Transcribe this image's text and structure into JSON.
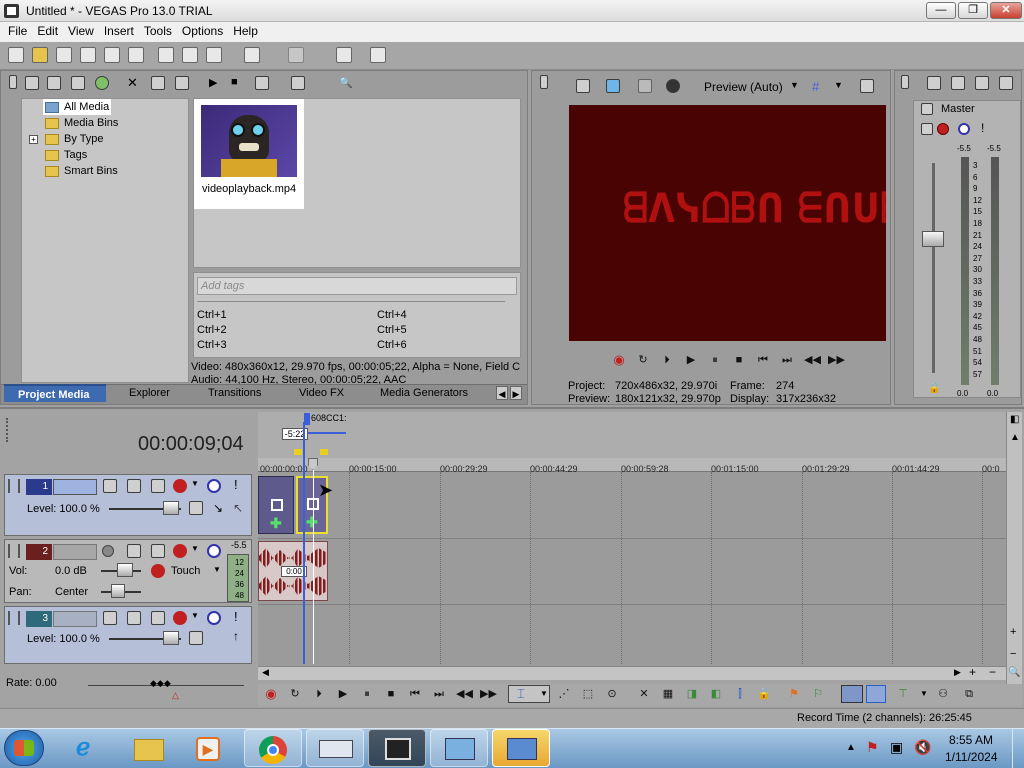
{
  "window": {
    "title": "Untitled * - VEGAS Pro 13.0 TRIAL",
    "minimize": "—",
    "maximize": "❐",
    "close": "✕"
  },
  "menu": [
    "File",
    "Edit",
    "View",
    "Insert",
    "Tools",
    "Options",
    "Help"
  ],
  "media_tree": [
    "All Media",
    "Media Bins",
    "By Type",
    "Tags",
    "Smart Bins"
  ],
  "media_item": {
    "filename": "videoplayback.mp4"
  },
  "tags": {
    "placeholder": "Add tags",
    "shortcuts": [
      "Ctrl+1",
      "Ctrl+2",
      "Ctrl+3",
      "Ctrl+4",
      "Ctrl+5",
      "Ctrl+6"
    ]
  },
  "media_info": {
    "video": "Video: 480x360x12, 29.970 fps, 00:00:05;22, Alpha = None, Field C",
    "audio": "Audio: 44,100 Hz, Stereo, 00:00:05;22, AAC"
  },
  "tabs": [
    "Project Media",
    "Explorer",
    "Transitions",
    "Video FX",
    "Media Generators"
  ],
  "preview": {
    "mode_label": "Preview (Auto)",
    "project_label": "Project:",
    "project_value": "720x486x32, 29.970i",
    "preview_label": "Preview:",
    "preview_value": "180x121x32, 29.970p",
    "frame_label": "Frame:",
    "frame_value": "274",
    "display_label": "Display:",
    "display_value": "317x236x32",
    "overlay_text": "ᗺᐱᓭᗝᗷᑎ ᗴᑎᑌᗷ"
  },
  "master": {
    "label": "Master",
    "left_db": "-5.5",
    "right_db": "-5.5",
    "ticks": [
      "3",
      "6",
      "9",
      "12",
      "15",
      "18",
      "21",
      "24",
      "27",
      "30",
      "33",
      "36",
      "39",
      "42",
      "45",
      "48",
      "51",
      "54",
      "57"
    ],
    "bottom_left": "0.0",
    "bottom_right": "0.0"
  },
  "timeline": {
    "timecode": "00:00:09;04",
    "marker_label": "608CC1:",
    "region_label": "-5:22",
    "ruler": [
      "00:00:00;00",
      "00:00:15;00",
      "00:00:29;29",
      "00:00:44;29",
      "00:00:59;28",
      "00:01:15;00",
      "00:01:29;29",
      "00:01:44;29",
      "00:0"
    ],
    "clip_audio_label": "0:00"
  },
  "tracks": [
    {
      "num": "1",
      "level_label": "Level: 100.0 %"
    },
    {
      "num": "2",
      "vol_label": "Vol:",
      "vol_value": "0.0 dB",
      "pan_label": "Pan:",
      "pan_value": "Center",
      "automation": "Touch",
      "meter_top": "-5.5",
      "meter_ticks": [
        "12",
        "24",
        "36",
        "48"
      ]
    },
    {
      "num": "3",
      "level_label": "Level: 100.0 %"
    }
  ],
  "rate": "Rate: 0.00",
  "status": "Record Time (2 channels): 26:25:45",
  "taskbar": {
    "time": "8:55 AM",
    "date": "1/11/2024"
  },
  "colors": {
    "preview_bg": "#4a0303",
    "preview_text": "#b01010",
    "clip_video": "#5e5a8c",
    "accent": "#2b7bd5"
  }
}
